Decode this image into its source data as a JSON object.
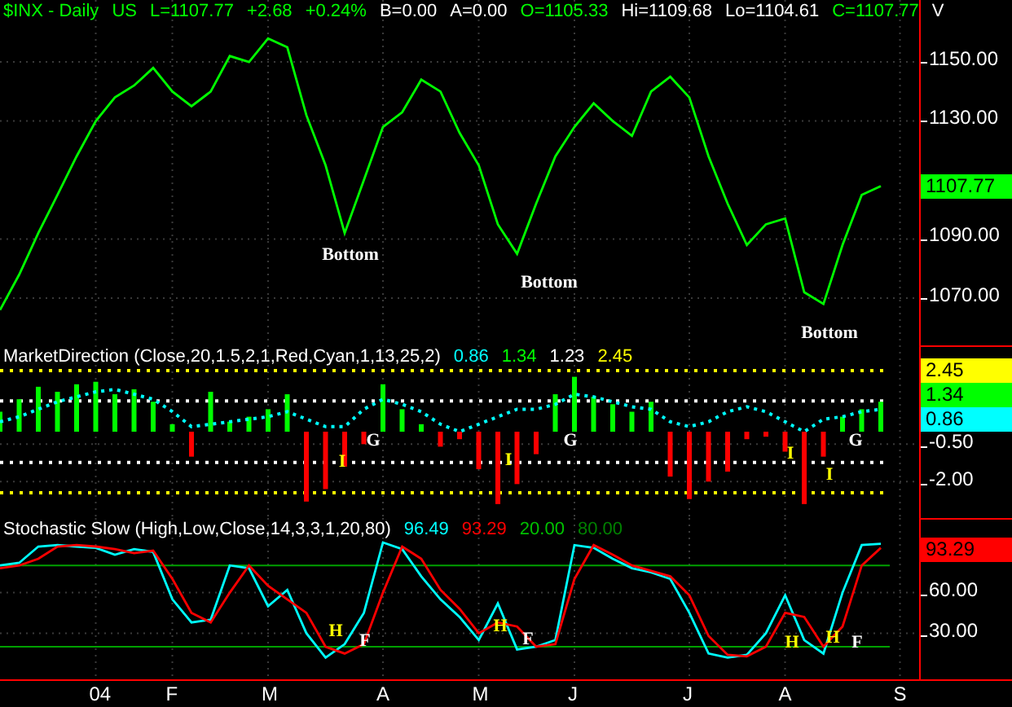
{
  "price_panel": {
    "header": [
      {
        "text": "$INX - Daily",
        "color": "#00ff00"
      },
      {
        "text": "US",
        "color": "#00ff00"
      },
      {
        "text": "L=1107.77",
        "color": "#00ff00"
      },
      {
        "text": "+2.68",
        "color": "#00ff00"
      },
      {
        "text": "+0.24%",
        "color": "#00ff00"
      },
      {
        "text": "B=0.00",
        "color": "#ffffff"
      },
      {
        "text": "A=0.00",
        "color": "#ffffff"
      },
      {
        "text": "O=1105.33",
        "color": "#00ff00"
      },
      {
        "text": "Hi=1109.68",
        "color": "#ffffff"
      },
      {
        "text": "Lo=1104.61",
        "color": "#ffffff"
      },
      {
        "text": "C=1107.77",
        "color": "#00ff00"
      },
      {
        "text": "V",
        "color": "#ffffff"
      }
    ],
    "value_labels": [
      {
        "text": "1107.77",
        "color": "#00ff00"
      }
    ],
    "markers": [
      {
        "text": "Bottom",
        "color": "#ffffff"
      },
      {
        "text": "Bottom",
        "color": "#ffffff"
      },
      {
        "text": "Bottom",
        "color": "#ffffff"
      }
    ],
    "chart_data": {
      "type": "line",
      "categories": [
        null,
        null,
        null,
        null,
        null,
        null,
        null,
        null,
        null,
        null,
        null,
        null,
        null,
        null,
        null,
        null,
        null,
        null,
        null,
        null,
        null,
        null,
        null,
        null,
        null,
        null,
        null,
        null,
        null,
        null,
        null,
        null,
        null,
        null,
        null,
        null,
        null,
        null,
        null,
        null,
        null,
        null,
        null,
        null,
        null,
        null,
        null,
        null
      ],
      "series": [
        {
          "color": "#00ff00",
          "values": [
            1066,
            1078,
            1092,
            1105,
            1118,
            1130,
            1138,
            1142,
            1148,
            1140,
            1135,
            1140,
            1152,
            1150,
            1158,
            1155,
            1132,
            1115,
            1092,
            1110,
            1128,
            1133,
            1144,
            1140,
            1126,
            1115,
            1095,
            1085,
            1102,
            1118,
            1128,
            1136,
            1130,
            1125,
            1140,
            1145,
            1138,
            1118,
            1102,
            1088,
            1095,
            1097,
            1072,
            1068,
            1088,
            1105,
            1108,
            null
          ]
        }
      ],
      "ylim": [
        1054,
        1171
      ],
      "grid": true,
      "yticks": [
        {
          "value": 1150,
          "label": "1150.00"
        },
        {
          "value": 1130,
          "label": "1130.00"
        },
        {
          "value": 1090,
          "label": "1090.00"
        },
        {
          "value": 1070,
          "label": "1070.00"
        }
      ]
    }
  },
  "indicator_panel": {
    "header": [
      {
        "text": "MarketDirection  (Close,20,1.5,2,1,Red,Cyan,1,13,25,2)",
        "color": "#ffffff"
      },
      {
        "text": "0.86",
        "color": "#00ffff"
      },
      {
        "text": "1.34",
        "color": "#00ff00"
      },
      {
        "text": "1.23",
        "color": "#ffffff"
      },
      {
        "text": "2.45",
        "color": "#ffff00"
      }
    ],
    "value_labels": [
      {
        "text": "2.45",
        "color": "#ffff00"
      },
      {
        "text": "1.34",
        "color": "#00ff00"
      },
      {
        "text": "0.86",
        "color": "#00ffff"
      }
    ],
    "markers": [
      {
        "text": "I",
        "color": "#ffff00"
      },
      {
        "text": "G",
        "color": "#ffffff"
      },
      {
        "text": "I",
        "color": "#ffff00"
      },
      {
        "text": "G",
        "color": "#ffffff"
      },
      {
        "text": "I",
        "color": "#ffff00"
      },
      {
        "text": "I",
        "color": "#ffff00"
      },
      {
        "text": "G",
        "color": "#ffffff"
      }
    ],
    "chart_data": {
      "type": "bar",
      "categories": [
        null,
        null,
        null,
        null,
        null,
        null,
        null,
        null,
        null,
        null,
        null,
        null,
        null,
        null,
        null,
        null,
        null,
        null,
        null,
        null,
        null,
        null,
        null,
        null,
        null,
        null,
        null,
        null,
        null,
        null,
        null,
        null,
        null,
        null,
        null,
        null,
        null,
        null,
        null,
        null,
        null,
        null,
        null,
        null,
        null,
        null,
        null,
        null
      ],
      "series": [
        {
          "color": "#00ff00",
          "values": [
            0.8,
            1.3,
            1.8,
            1.6,
            1.9,
            2.0,
            1.5,
            1.7,
            1.2,
            0.3,
            null,
            1.6,
            0.4,
            0.6,
            0.9,
            1.5,
            null,
            null,
            null,
            null,
            1.9,
            0.9,
            0.3,
            null,
            null,
            null,
            null,
            null,
            null,
            1.5,
            2.2,
            1.4,
            1.1,
            0.8,
            1.2,
            null,
            null,
            null,
            null,
            null,
            null,
            null,
            null,
            null,
            0.6,
            0.9,
            1.2,
            null
          ]
        },
        {
          "color": "#ff0000",
          "values": [
            null,
            null,
            null,
            null,
            null,
            null,
            null,
            null,
            null,
            null,
            -1.0,
            null,
            null,
            null,
            null,
            null,
            -2.8,
            -2.3,
            -1.4,
            -0.5,
            null,
            null,
            null,
            -0.6,
            -0.3,
            -1.5,
            -2.9,
            -2.1,
            -0.9,
            null,
            null,
            null,
            null,
            null,
            null,
            -1.8,
            -2.7,
            -2.0,
            -1.6,
            -0.3,
            -0.2,
            -0.8,
            -2.9,
            -1.0,
            null,
            null,
            null,
            null
          ]
        },
        {
          "type": "line",
          "line_style": "dotted",
          "color": "#00ffff",
          "values": [
            0.4,
            0.6,
            0.9,
            1.2,
            1.4,
            1.6,
            1.7,
            1.5,
            1.3,
            0.8,
            0.2,
            0.3,
            0.4,
            0.5,
            0.6,
            0.8,
            0.5,
            0.2,
            0.2,
            0.9,
            1.3,
            1.1,
            0.8,
            0.3,
            0.0,
            0.3,
            0.6,
            0.9,
            0.9,
            1.1,
            1.5,
            1.4,
            1.2,
            1.0,
            0.9,
            0.4,
            0.2,
            0.4,
            0.8,
            1.0,
            0.8,
            0.4,
            0.0,
            0.5,
            0.6,
            0.8,
            0.9,
            null
          ]
        }
      ],
      "ylim": [
        -3.46,
        3.46
      ],
      "yticks": [
        {
          "value": -0.5,
          "label": "-0.50"
        },
        {
          "value": -2,
          "label": "-2.00"
        }
      ],
      "grid": true,
      "ref_lines": [
        {
          "axis": "y",
          "value": 2.45,
          "color": "#ffff00"
        },
        {
          "axis": "y",
          "value": 1.23,
          "color": "#ffffff"
        },
        {
          "axis": "y",
          "value": -1.23,
          "color": "#ffffff"
        },
        {
          "axis": "y",
          "value": -2.45,
          "color": "#ffff00"
        }
      ]
    }
  },
  "stochastic_panel": {
    "header": [
      {
        "text": "Stochastic Slow  (High,Low,Close,14,3,3,1,20,80)",
        "color": "#ffffff"
      },
      {
        "text": "96.49",
        "color": "#00ffff"
      },
      {
        "text": "93.29",
        "color": "#ff0000"
      },
      {
        "text": "20.00",
        "color": "#00c000"
      },
      {
        "text": "80.00",
        "color": "#008000"
      }
    ],
    "value_labels": [
      {
        "text": "93.29",
        "color": "#ff0000"
      }
    ],
    "markers": [
      {
        "text": "H",
        "color": "#ffff00"
      },
      {
        "text": "F",
        "color": "#ffffff"
      },
      {
        "text": "H",
        "color": "#ffff00"
      },
      {
        "text": "F",
        "color": "#ffffff"
      },
      {
        "text": "H",
        "color": "#ffff00"
      },
      {
        "text": "H",
        "color": "#ffff00"
      },
      {
        "text": "F",
        "color": "#ffffff"
      }
    ],
    "chart_data": {
      "type": "line",
      "categories": [
        null,
        null,
        null,
        null,
        null,
        "04",
        null,
        null,
        null,
        "F",
        null,
        null,
        null,
        null,
        "M",
        null,
        null,
        null,
        null,
        null,
        "A",
        null,
        null,
        null,
        null,
        "M",
        null,
        null,
        null,
        null,
        "J",
        null,
        null,
        null,
        null,
        null,
        "J",
        null,
        null,
        null,
        null,
        "A",
        null,
        null,
        null,
        null,
        null,
        "S"
      ],
      "series": [
        {
          "color": "#00ffff",
          "values": [
            80,
            82,
            94,
            95,
            94,
            93,
            88,
            92,
            90,
            55,
            38,
            40,
            80,
            78,
            50,
            62,
            30,
            12,
            22,
            45,
            97,
            92,
            72,
            55,
            42,
            25,
            52,
            18,
            20,
            25,
            95,
            93,
            85,
            78,
            75,
            70,
            45,
            15,
            12,
            14,
            30,
            58,
            25,
            15,
            60,
            95,
            96,
            null
          ]
        },
        {
          "color": "#ff0000",
          "values": [
            78,
            80,
            85,
            94,
            95,
            94,
            92,
            89,
            91,
            70,
            45,
            38,
            60,
            80,
            65,
            55,
            45,
            20,
            15,
            22,
            60,
            94,
            85,
            62,
            48,
            30,
            38,
            35,
            20,
            22,
            70,
            95,
            88,
            80,
            76,
            72,
            58,
            28,
            14,
            13,
            20,
            45,
            42,
            20,
            35,
            80,
            93,
            null
          ]
        }
      ],
      "ylim": [
        -4,
        115
      ],
      "grid": true,
      "yticks": [
        {
          "value": 60,
          "label": "60.00"
        },
        {
          "value": 30,
          "label": "30.00"
        }
      ],
      "ref_lines": [
        {
          "axis": "y",
          "value": 80,
          "color": "#00a000"
        },
        {
          "axis": "y",
          "value": 20,
          "color": "#00a000"
        }
      ]
    }
  }
}
